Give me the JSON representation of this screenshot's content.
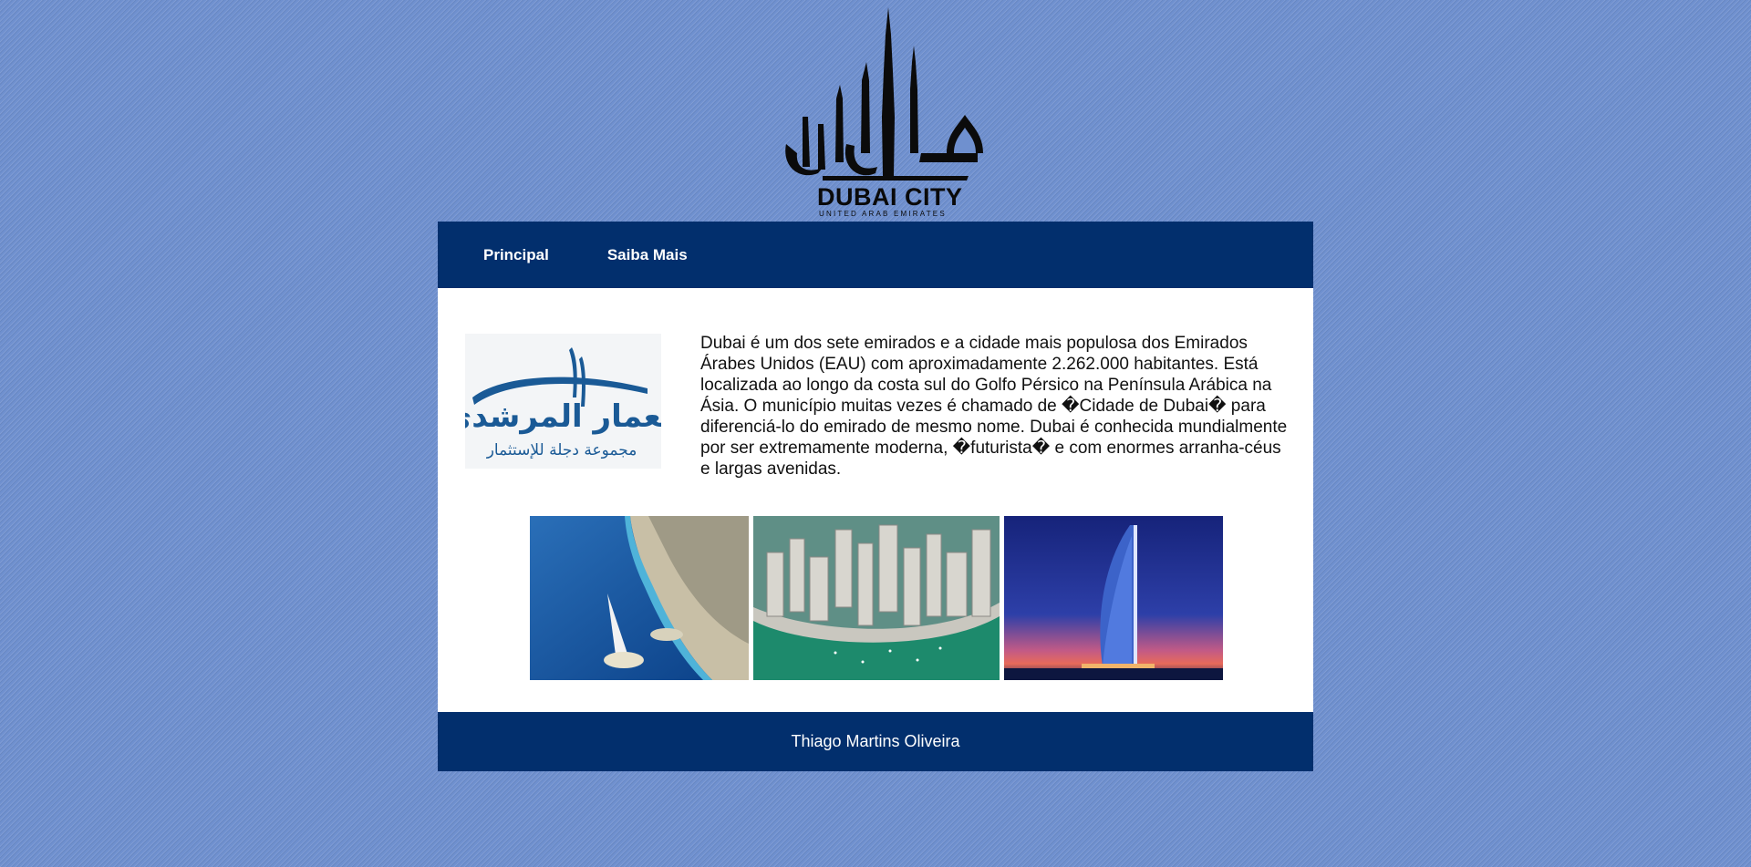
{
  "header": {
    "logo_title": "DUBAI CITY",
    "logo_subtitle": "UNITED ARAB EMIRATES",
    "logo_icon": "dubai-skyline-calligraphy-logo"
  },
  "nav": {
    "items": [
      {
        "label": "Principal"
      },
      {
        "label": "Saiba Mais"
      }
    ]
  },
  "main": {
    "brand_logo": {
      "icon": "muamar-almurshidi-logo",
      "arabic_title": "معمار المرشدي",
      "arabic_subtitle": "مجموعة دجلة للإستثمار"
    },
    "description": "Dubai é um dos sete emirados e a cidade mais populosa dos Emirados Árabes Unidos (EAU) com aproximadamente 2.262.000 habitantes. Está localizada ao longo da costa sul do Golfo Pérsico na Península Arábica na Ásia. O município muitas vezes é chamado de �Cidade de Dubai� para diferenciá-lo do emirado de mesmo nome. Dubai é conhecida mundialmente por ser extremamente moderna, �futurista� e com enormes arranha-céus e largas avenidas.",
    "gallery": [
      {
        "icon": "dubai-coast-aerial-photo"
      },
      {
        "icon": "dubai-marina-towers-photo"
      },
      {
        "icon": "burj-al-arab-night-photo"
      }
    ]
  },
  "footer": {
    "text": "Thiago Martins Oliveira"
  },
  "colors": {
    "background": "#6f90cf",
    "nav_background": "#022f6d",
    "content_background": "#ffffff",
    "brand_blue": "#1a5a96"
  }
}
